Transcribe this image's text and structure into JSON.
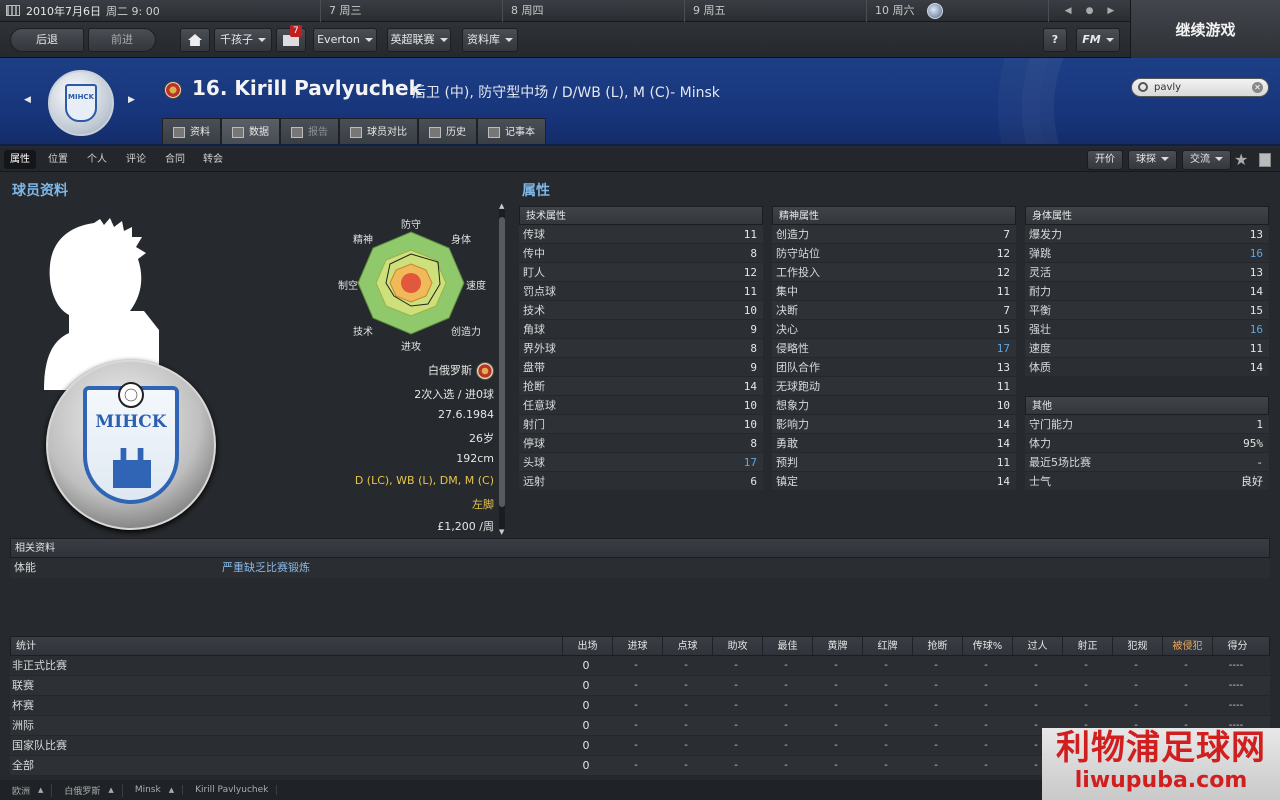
{
  "topbar": {
    "date": "2010年7月6日",
    "time": "周二 9: 00",
    "days": [
      "7 周三",
      "8 周四",
      "9 周五",
      "10 周六"
    ]
  },
  "continue_label": "继续游戏",
  "toolbar": {
    "back": "后退",
    "forward": "前进",
    "manager": "千孩子",
    "mail_count": "7",
    "club": "Everton",
    "league": "英超联赛",
    "database": "资料库",
    "help": "?",
    "fm": "FM"
  },
  "header": {
    "player_name": "16. Kirill Pavlyuchek",
    "positions": "后卫 (中), 防守型中场 / D/WB (L), M (C)- Minsk",
    "search_value": "pavly",
    "tabs": [
      "资料",
      "数据",
      "报告",
      "球员对比",
      "历史",
      "记事本"
    ]
  },
  "subnav": {
    "items": [
      "属性",
      "位置",
      "个人",
      "评论",
      "合同",
      "转会"
    ],
    "right_buttons": [
      "开价",
      "球探",
      "交流"
    ]
  },
  "profile": {
    "title": "球员资料",
    "radar_labels": [
      "防守",
      "身体",
      "速度",
      "创造力",
      "进攻",
      "技术",
      "制空",
      "精神"
    ],
    "nationality": "白俄罗斯",
    "caps": "2次入选 / 进0球",
    "birth_date": "27.6.1984",
    "age": "26岁",
    "height": "192cm",
    "positions_short": "D (LC), WB (L), DM, M (C)",
    "foot": "左脚",
    "wage": "£1,200 /周",
    "club_badge_text": "MIHCK"
  },
  "attributes": {
    "title": "属性",
    "technical": {
      "header": "技术属性",
      "rows": [
        {
          "name": "传球",
          "value": "11"
        },
        {
          "name": "传中",
          "value": "8"
        },
        {
          "name": "盯人",
          "value": "12"
        },
        {
          "name": "罚点球",
          "value": "11"
        },
        {
          "name": "技术",
          "value": "10"
        },
        {
          "name": "角球",
          "value": "9"
        },
        {
          "name": "界外球",
          "value": "8"
        },
        {
          "name": "盘带",
          "value": "9"
        },
        {
          "name": "抢断",
          "value": "14"
        },
        {
          "name": "任意球",
          "value": "10"
        },
        {
          "name": "射门",
          "value": "10"
        },
        {
          "name": "停球",
          "value": "8"
        },
        {
          "name": "头球",
          "value": "17"
        },
        {
          "name": "远射",
          "value": "6"
        }
      ]
    },
    "mental": {
      "header": "精神属性",
      "rows": [
        {
          "name": "创造力",
          "value": "7"
        },
        {
          "name": "防守站位",
          "value": "12"
        },
        {
          "name": "工作投入",
          "value": "12"
        },
        {
          "name": "集中",
          "value": "11"
        },
        {
          "name": "决断",
          "value": "7"
        },
        {
          "name": "决心",
          "value": "15"
        },
        {
          "name": "侵略性",
          "value": "17"
        },
        {
          "name": "团队合作",
          "value": "13"
        },
        {
          "name": "无球跑动",
          "value": "11"
        },
        {
          "name": "想象力",
          "value": "10"
        },
        {
          "name": "影响力",
          "value": "14"
        },
        {
          "name": "勇敢",
          "value": "14"
        },
        {
          "name": "预判",
          "value": "11"
        },
        {
          "name": "镇定",
          "value": "14"
        }
      ]
    },
    "physical": {
      "header": "身体属性",
      "rows": [
        {
          "name": "爆发力",
          "value": "13"
        },
        {
          "name": "弹跳",
          "value": "16"
        },
        {
          "name": "灵活",
          "value": "13"
        },
        {
          "name": "耐力",
          "value": "14"
        },
        {
          "name": "平衡",
          "value": "15"
        },
        {
          "name": "强壮",
          "value": "16"
        },
        {
          "name": "速度",
          "value": "11"
        },
        {
          "name": "体质",
          "value": "14"
        }
      ]
    },
    "other": {
      "header": "其他",
      "rows": [
        {
          "name": "守门能力",
          "value": "1"
        },
        {
          "name": "体力",
          "value": "95%"
        },
        {
          "name": "最近5场比赛",
          "value": "-"
        },
        {
          "name": "士气",
          "value": "良好"
        }
      ]
    }
  },
  "related": {
    "header": "相关资料",
    "row_label": "体能",
    "row_value": "严重缺乏比赛锻炼"
  },
  "stats": {
    "columns": [
      "统计",
      "出场",
      "进球",
      "点球",
      "助攻",
      "最佳",
      "黄牌",
      "红牌",
      "抢断",
      "传球%",
      "过人",
      "射正",
      "犯规",
      "被侵犯",
      "得分"
    ],
    "rows": [
      {
        "label": "非正式比赛",
        "values": [
          "0",
          "-",
          "-",
          "-",
          "-",
          "-",
          "-",
          "-",
          "-",
          "-",
          "-",
          "-",
          "-",
          "----"
        ]
      },
      {
        "label": "联赛",
        "values": [
          "0",
          "-",
          "-",
          "-",
          "-",
          "-",
          "-",
          "-",
          "-",
          "-",
          "-",
          "-",
          "-",
          "----"
        ]
      },
      {
        "label": "杯赛",
        "values": [
          "0",
          "-",
          "-",
          "-",
          "-",
          "-",
          "-",
          "-",
          "-",
          "-",
          "-",
          "-",
          "-",
          "----"
        ]
      },
      {
        "label": "洲际",
        "values": [
          "0",
          "-",
          "-",
          "-",
          "-",
          "-",
          "-",
          "-",
          "-",
          "-",
          "-",
          "-",
          "-",
          "----"
        ]
      },
      {
        "label": "国家队比赛",
        "values": [
          "0",
          "-",
          "-",
          "-",
          "-",
          "-",
          "-",
          "-",
          "-",
          "-",
          "-",
          "-",
          "-",
          "----"
        ]
      },
      {
        "label": "全部",
        "values": [
          "0",
          "-",
          "-",
          "-",
          "-",
          "-",
          "-",
          "-",
          "-",
          "-",
          "-",
          "-",
          "-",
          "----"
        ]
      }
    ]
  },
  "breadcrumb": [
    "欧洲",
    "白俄罗斯",
    "Minsk",
    "Kirill Pavlyuchek"
  ],
  "watermark": {
    "cn": "利物浦足球网",
    "url": "liwupuba.com"
  },
  "colors": {
    "header_blue": "#1d3f86",
    "accent_blue": "#7fb7e6",
    "highlight_value": "#5ea6e0",
    "yellow": "#e7c64a",
    "watermark_red": "#d11e1e"
  }
}
